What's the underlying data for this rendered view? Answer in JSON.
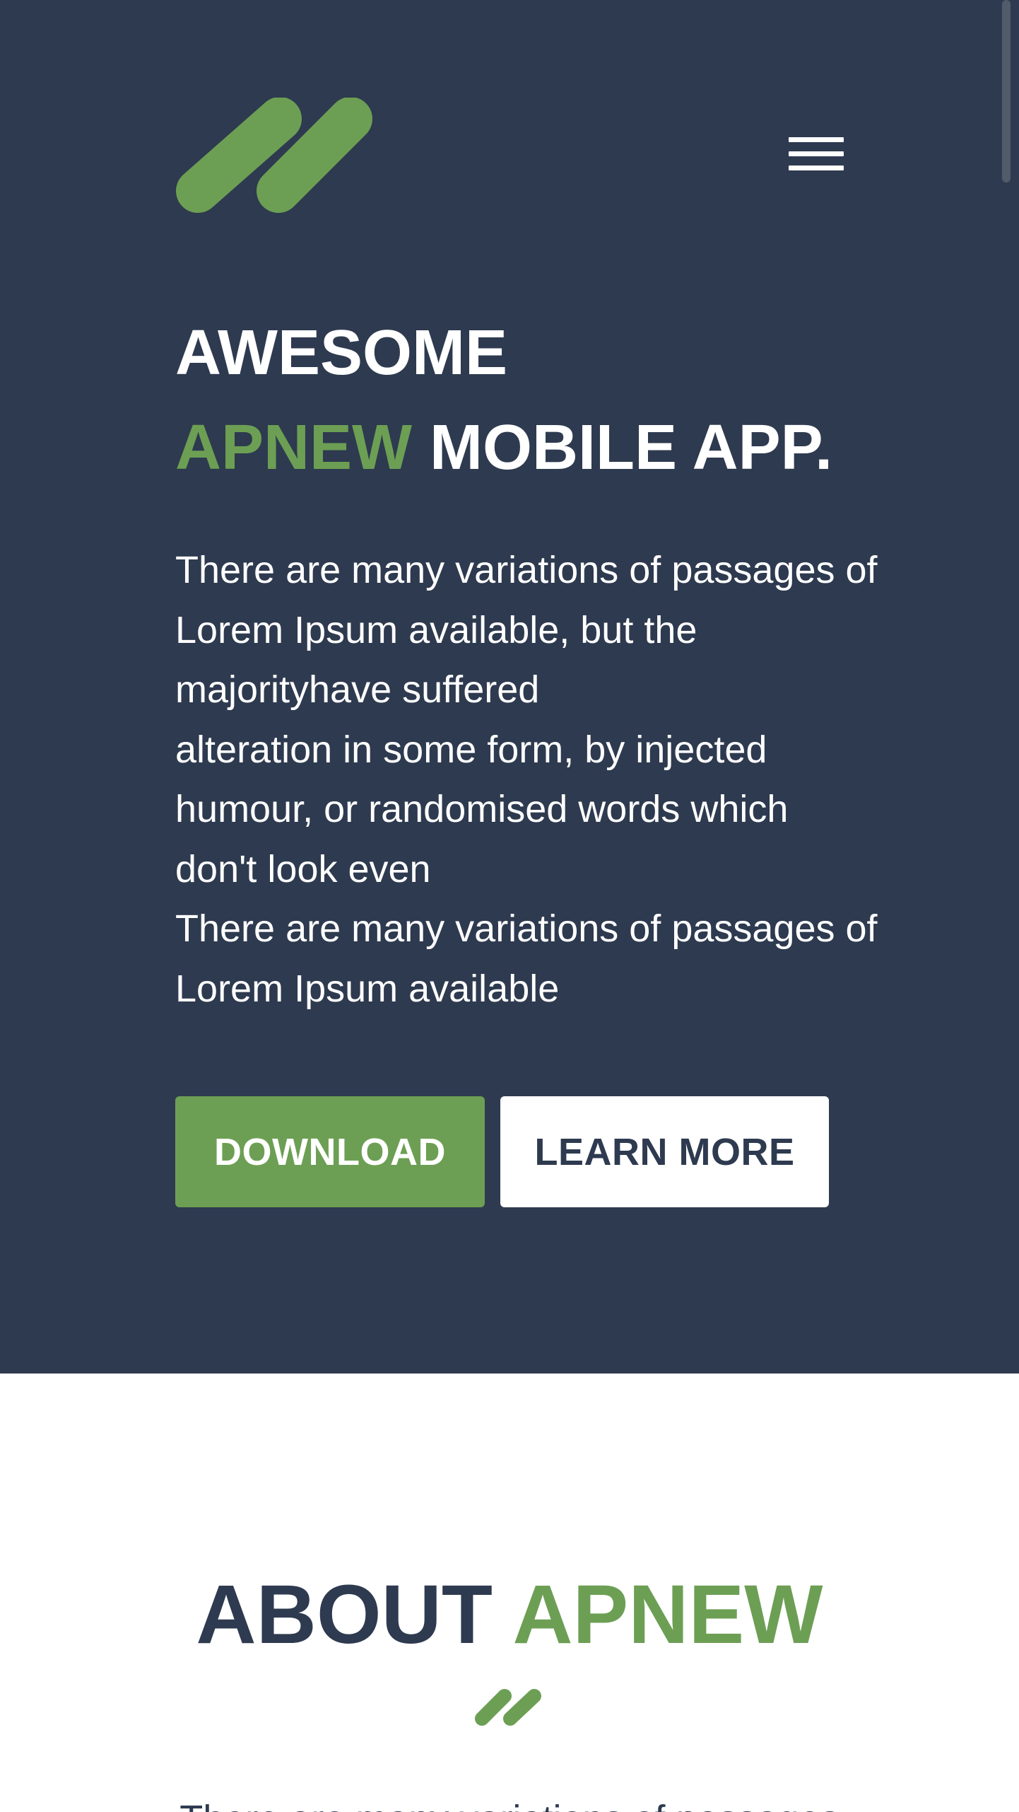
{
  "header": {
    "logo_icon": "double-slash-logo-icon",
    "menu_icon": "hamburger-menu-icon"
  },
  "hero": {
    "title_line1": "AWESOME",
    "title_accent": "APNEW",
    "title_rest": " MOBILE APP.",
    "description_lines": [
      "There are many variations of passages of",
      "Lorem Ipsum available, but the",
      "majorityhave suffered",
      "alteration in some form, by injected",
      "humour, or randomised words which",
      "don't look even",
      "There are many variations of passages of",
      "Lorem Ipsum available"
    ],
    "download_label": "DOWNLOAD",
    "learn_more_label": "LEARN MORE"
  },
  "about": {
    "title_main": "ABOUT ",
    "title_accent": "APNEW",
    "divider_icon": "double-slash-icon",
    "text_start": "There are many variations of passages"
  },
  "colors": {
    "hero_bg": "#2e3a4f",
    "accent": "#6c9f54",
    "white": "#ffffff"
  }
}
